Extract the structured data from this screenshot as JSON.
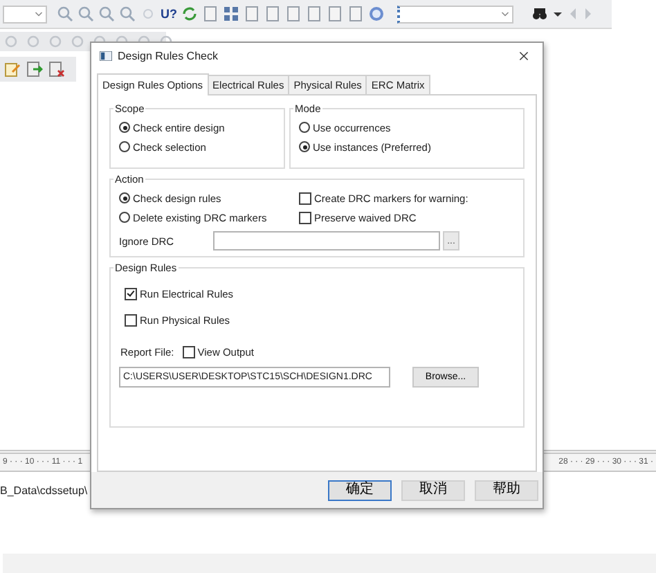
{
  "toolbar": {
    "annotate_text": "U?"
  },
  "ruler": {
    "left": "9 · · · 10 · · · 11 · · · 1",
    "right": "28 · · · 29 · · · 30 · · · 31 ·"
  },
  "output_text": "B_Data\\cdssetup\\",
  "dialog": {
    "title": "Design Rules Check",
    "tabs": [
      {
        "label": "Design Rules Options",
        "selected": true
      },
      {
        "label": "Electrical Rules",
        "selected": false
      },
      {
        "label": "Physical Rules",
        "selected": false
      },
      {
        "label": "ERC Matrix",
        "selected": false
      }
    ],
    "scope": {
      "label": "Scope",
      "options": [
        {
          "label": "Check entire design",
          "selected": true
        },
        {
          "label": "Check selection",
          "selected": false
        }
      ]
    },
    "mode": {
      "label": "Mode",
      "options": [
        {
          "label": "Use occurrences",
          "selected": false
        },
        {
          "label": "Use instances (Preferred)",
          "selected": true
        }
      ]
    },
    "action": {
      "label": "Action",
      "options": [
        {
          "label": "Check design rules",
          "selected": true
        },
        {
          "label": "Delete existing DRC markers",
          "selected": false
        }
      ],
      "checkboxes": [
        {
          "label": "Create DRC markers for warning:",
          "checked": false
        },
        {
          "label": "Preserve waived DRC",
          "checked": false
        }
      ],
      "ignore_label": "Ignore DRC",
      "ignore_button": "..."
    },
    "design_rules": {
      "label": "Design Rules",
      "checkboxes": [
        {
          "label": "Run Electrical Rules",
          "checked": true
        },
        {
          "label": "Run Physical Rules",
          "checked": false
        }
      ],
      "report_label": "Report File:",
      "view_output": {
        "label": "View Output",
        "checked": false
      },
      "path": "C:\\USERS\\USER\\DESKTOP\\STC15\\SCH\\DESIGN1.DRC",
      "browse": "Browse..."
    },
    "buttons": [
      {
        "label": "确定",
        "default": true
      },
      {
        "label": "取消",
        "default": false
      },
      {
        "label": "帮助",
        "default": false
      }
    ]
  }
}
